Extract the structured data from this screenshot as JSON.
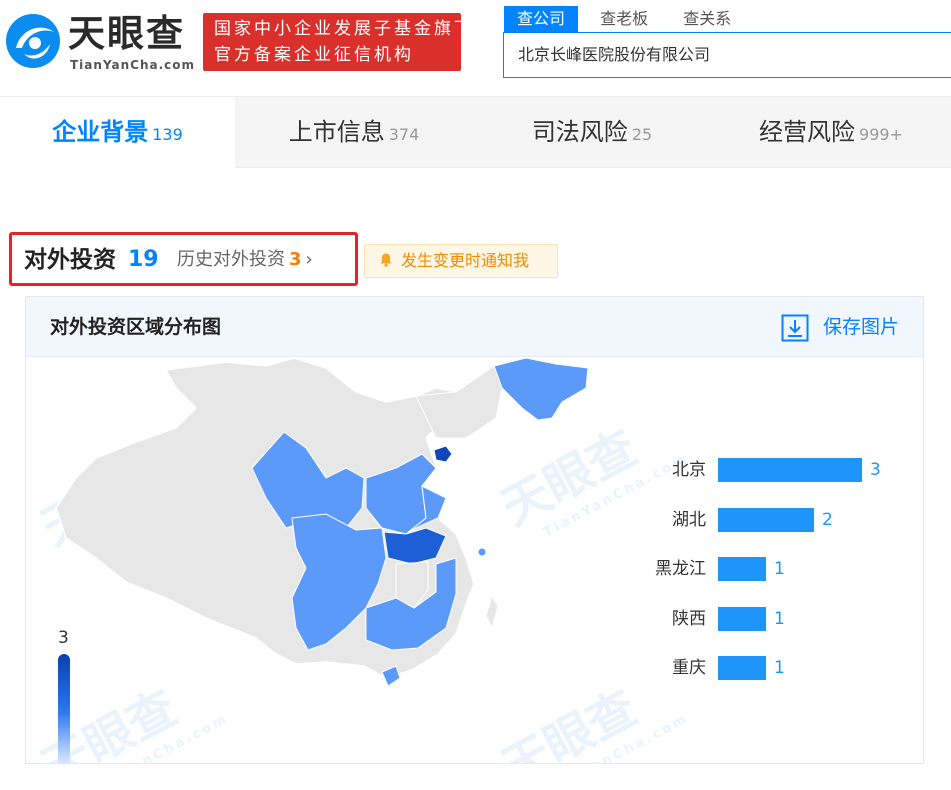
{
  "header": {
    "logo_text": "天眼查",
    "logo_sub": "TianYanCha.com",
    "badge_line1": "国家中小企业发展子基金旗下",
    "badge_line2": "官方备案企业征信机构",
    "search_tabs": [
      "查公司",
      "查老板",
      "查关系"
    ],
    "search_value": "北京长峰医院股份有限公司"
  },
  "nav": {
    "tabs": [
      {
        "label": "企业背景",
        "count": "139"
      },
      {
        "label": "上市信息",
        "count": "374"
      },
      {
        "label": "司法风险",
        "count": "25"
      },
      {
        "label": "经营风险",
        "count": "999+"
      }
    ]
  },
  "section": {
    "title": "对外投资",
    "count": "19",
    "history_label": "历史对外投资",
    "history_count": "3",
    "chevron": "›",
    "notify_label": "发生变更时通知我"
  },
  "card": {
    "title": "对外投资区域分布图",
    "save_label": "保存图片"
  },
  "chart_data": {
    "type": "bar",
    "orientation": "horizontal",
    "categories": [
      "北京",
      "湖北",
      "黑龙江",
      "陕西",
      "重庆"
    ],
    "values": [
      3,
      2,
      1,
      1,
      1
    ],
    "xlim": [
      0,
      3
    ],
    "legend_max": "3",
    "legend_min": "0",
    "bar_color": "#1e95f8"
  },
  "colors": {
    "accent": "#0084ff",
    "badge_red": "#d9302c",
    "highlight_border": "#e8202a",
    "history_count": "#fa7d00",
    "notify": "#f08c00"
  },
  "icons": {
    "notify": "bell-icon",
    "save": "download-icon",
    "logo": "tianyancha-logo-icon"
  }
}
